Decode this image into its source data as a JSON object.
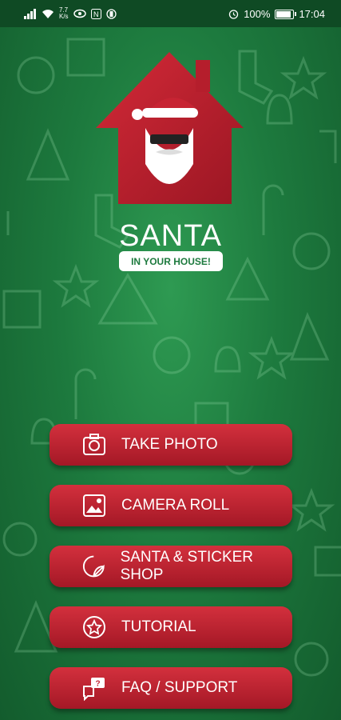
{
  "status_bar": {
    "network_speed_value": "7.7",
    "network_speed_unit": "K/s",
    "battery": "100%",
    "time": "17:04"
  },
  "app": {
    "title": "SANTA",
    "subtitle": "IN YOUR HOUSE!"
  },
  "menu": [
    {
      "label": "TAKE PHOTO",
      "icon": "camera-icon"
    },
    {
      "label": "CAMERA ROLL",
      "icon": "gallery-icon"
    },
    {
      "label": "SANTA & STICKER SHOP",
      "icon": "sticker-icon"
    },
    {
      "label": "TUTORIAL",
      "icon": "star-badge-icon"
    },
    {
      "label": "FAQ / SUPPORT",
      "icon": "chat-question-icon"
    }
  ],
  "colors": {
    "background": "#1d7a3e",
    "button": "#c32433",
    "logo_house": "#c0212f"
  }
}
